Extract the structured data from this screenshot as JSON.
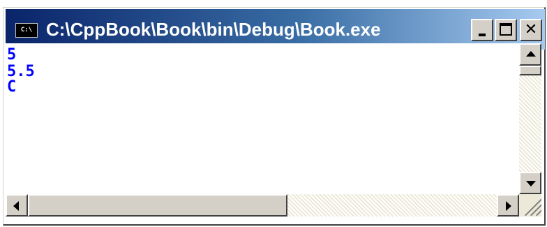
{
  "window": {
    "title": "C:\\CppBook\\Book\\bin\\Debug\\Book.exe",
    "icon_label": "C:\\",
    "icon_name": "console-app-icon",
    "title_bar_color": "#0a246a"
  },
  "caption_buttons": {
    "minimize": "minimize-icon",
    "maximize": "maximize-icon",
    "close_glyph": "✕"
  },
  "console": {
    "text_color": "#0000ff",
    "background": "#ffffff",
    "lines": [
      "5",
      "5.5",
      "C"
    ]
  },
  "scrollbars": {
    "vertical": {
      "up_icon": "arrow-up-icon",
      "down_icon": "arrow-down-icon"
    },
    "horizontal": {
      "left_icon": "arrow-left-icon",
      "right_icon": "arrow-right-icon"
    }
  }
}
